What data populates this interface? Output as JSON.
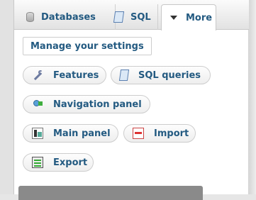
{
  "tabs": [
    {
      "label": "Databases",
      "icon": "database-icon"
    },
    {
      "label": "SQL",
      "icon": "sql-icon"
    },
    {
      "label": "More",
      "icon": "chevron-down-icon"
    }
  ],
  "menu": {
    "manage_settings": "Manage your settings",
    "features": "Features",
    "sql_queries": "SQL queries",
    "navigation_panel": "Navigation panel",
    "main_panel": "Main panel",
    "import": "Import",
    "export": "Export"
  }
}
